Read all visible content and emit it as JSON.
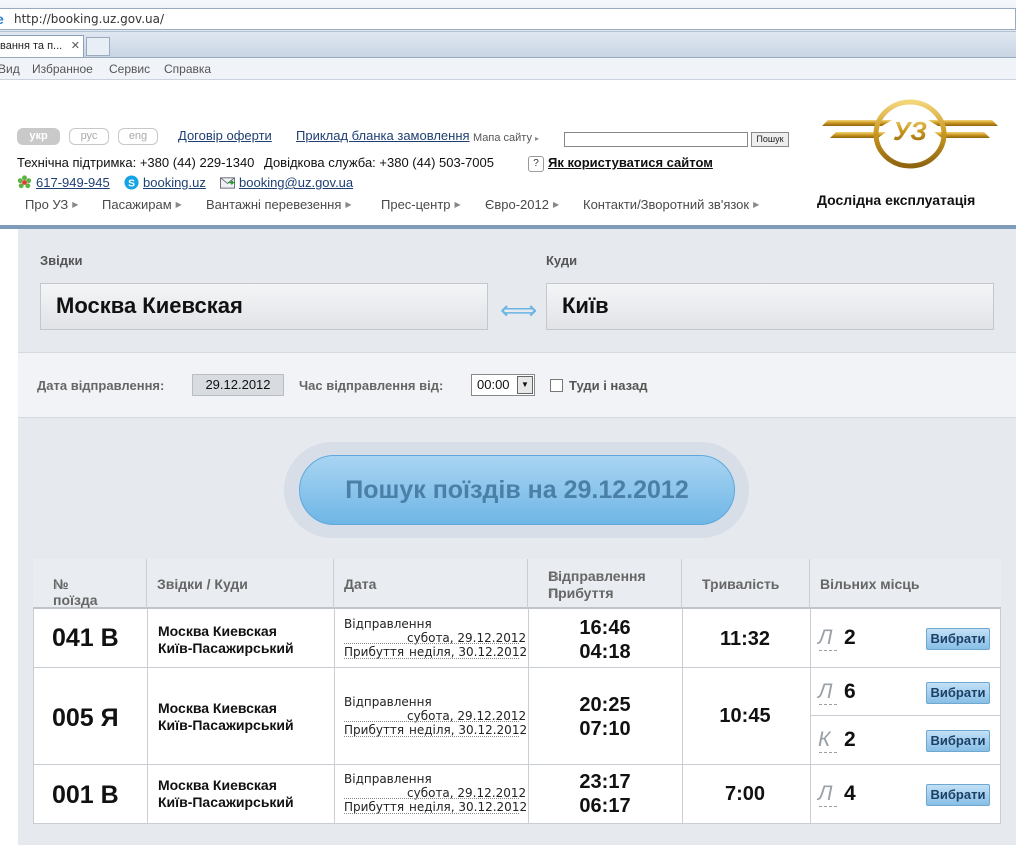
{
  "browser": {
    "url": "http://booking.uz.gov.ua/",
    "tab_title": "вання та п...",
    "tab_close": "✕",
    "menu": [
      "Вид",
      "Избранное",
      "Сервис",
      "Справка"
    ]
  },
  "header": {
    "langs": [
      "укр",
      "рус",
      "eng"
    ],
    "links": [
      "Договір оферти",
      "Приклад бланка замовлення"
    ],
    "sitemap": "Мапа сайту",
    "search_button": "Пошук",
    "support": "Технічна підтримка: +380 (44) 229-1340",
    "info": "Довідкова служба: +380 (44) 503-7005",
    "help_q": "?",
    "help_link": "Як користуватися сайтом",
    "icq": "617-949-945",
    "skype": "booking.uz",
    "email": "booking@uz.gov.ua",
    "nav": [
      "Про УЗ",
      "Пасажирам",
      "Вантажні перевезення",
      "Прес-центр",
      "Євро-2012",
      "Контакти/Зворотний зв'язок"
    ],
    "logo_text": "УЗ",
    "trial": "Дослідна експлуатація"
  },
  "form": {
    "from_label": "Звідки",
    "to_label": "Куди",
    "from_value": "Москва Киевская",
    "to_value": "Київ",
    "swap_icon": "⟺",
    "date_label": "Дата відправлення:",
    "date_value": "29.12.2012",
    "time_label": "Час відправлення від:",
    "time_value": "00:00",
    "roundtrip_label": "Туди і назад",
    "search_button": "Пошук поїздів на 29.12.2012"
  },
  "table": {
    "headers": {
      "train": "№ поїзда",
      "route": "Звідки / Куди",
      "date": "Дата",
      "dep": "Відправлення",
      "arr": "Прибуття",
      "dur": "Тривалість",
      "seats": "Вільних місць",
      "sort": "↑↓"
    },
    "dep_label": "Відправлення",
    "arr_label": "Прибуття",
    "choose_label": "Вибрати",
    "rows": [
      {
        "num": "041 В",
        "from": "Москва Киевская",
        "to": "Київ-Пасажирський",
        "dep_date": "субота, 29.12.2012",
        "arr_date": "неділя, 30.12.2012",
        "dep_time": "16:46",
        "arr_time": "04:18",
        "duration": "11:32",
        "seats": [
          {
            "cls": "Л",
            "n": "2"
          }
        ]
      },
      {
        "num": "005 Я",
        "from": "Москва Киевская",
        "to": "Київ-Пасажирський",
        "dep_date": "субота, 29.12.2012",
        "arr_date": "неділя, 30.12.2012",
        "dep_time": "20:25",
        "arr_time": "07:10",
        "duration": "10:45",
        "seats": [
          {
            "cls": "Л",
            "n": "6"
          },
          {
            "cls": "К",
            "n": "2"
          }
        ]
      },
      {
        "num": "001 В",
        "from": "Москва Киевская",
        "to": "Київ-Пасажирський",
        "dep_date": "субота, 29.12.2012",
        "arr_date": "неділя, 30.12.2012",
        "dep_time": "23:17",
        "arr_time": "06:17",
        "duration": "7:00",
        "seats": [
          {
            "cls": "Л",
            "n": "4"
          }
        ]
      }
    ]
  }
}
